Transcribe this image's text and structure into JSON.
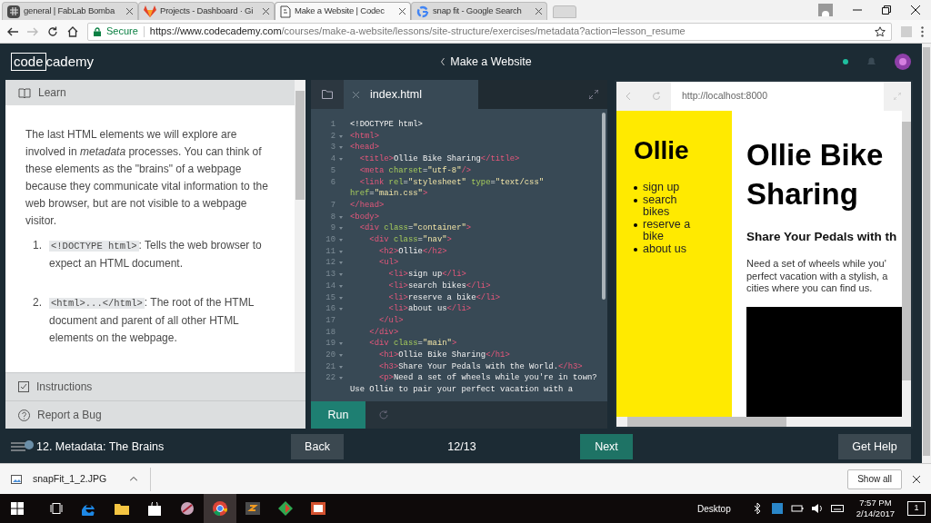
{
  "browser": {
    "tabs": [
      {
        "title": "general | FabLab Bomba",
        "kind": "hash",
        "selected": false
      },
      {
        "title": "Projects - Dashboard · Gi",
        "kind": "fox",
        "selected": false
      },
      {
        "title": "Make a Website | Codec",
        "kind": "page",
        "selected": true
      },
      {
        "title": "snap fit - Google Search",
        "kind": "g",
        "selected": false
      }
    ],
    "secure_label": "Secure",
    "url_host": "https://www.codecademy.com",
    "url_path": "/courses/make-a-website/lessons/site-structure/exercises/metadata?action=lesson_resume"
  },
  "header": {
    "logo_boxed": "code",
    "logo_rest": "cademy",
    "course": "Make a Website"
  },
  "learn": {
    "tabs": [
      {
        "label": "Learn",
        "kind": "book"
      },
      {
        "label": "Instructions",
        "kind": "check"
      },
      {
        "label": "Report a Bug",
        "kind": "help"
      }
    ],
    "intro": "The last HTML elements we will explore are involved in *metadata* processes. You can think of these elements as the \"brains\" of a webpage because they communicate vital information to the web browser, but are not visible to a webpage visitor.",
    "items": [
      {
        "number": "1.",
        "code": "<!DOCTYPE html>",
        "text": ": Tells the web browser to expect an HTML document."
      },
      {
        "number": "2.",
        "code": "<html>...</html>",
        "text": ": The root of the HTML document and parent of all other HTML elements on the webpage."
      }
    ]
  },
  "editor": {
    "file": "index.html",
    "run": "Run",
    "lines": [
      {
        "kind": "line",
        "number": "1",
        "foldable": false,
        "tokens": [
          {
            "kind": "text",
            "text": "<!DOCTYPE html>"
          }
        ]
      },
      {
        "kind": "line",
        "number": "2",
        "foldable": true,
        "tokens": [
          {
            "kind": "tag",
            "text": "<html>"
          }
        ]
      },
      {
        "kind": "line",
        "number": "3",
        "foldable": true,
        "tokens": [
          {
            "kind": "tag",
            "text": "<head>"
          }
        ]
      },
      {
        "kind": "line",
        "number": "4",
        "foldable": true,
        "tokens": [
          {
            "kind": "tag",
            "text": "  <title>"
          },
          {
            "kind": "text",
            "text": "Ollie Bike Sharing"
          },
          {
            "kind": "tag",
            "text": "</title>"
          }
        ]
      },
      {
        "kind": "line",
        "number": "5",
        "foldable": false,
        "tokens": [
          {
            "kind": "tag",
            "text": "  <meta"
          },
          {
            "kind": "attr",
            "text": " charset"
          },
          {
            "kind": "text",
            "text": "="
          },
          {
            "kind": "string",
            "text": "\"utf-8\""
          },
          {
            "kind": "tag",
            "text": "/>"
          }
        ]
      },
      {
        "kind": "line",
        "number": "6",
        "foldable": false,
        "tokens": [
          {
            "kind": "tag",
            "text": "  <link"
          },
          {
            "kind": "attr",
            "text": " rel"
          },
          {
            "kind": "text",
            "text": "="
          },
          {
            "kind": "string",
            "text": "\"stylesheet\""
          },
          {
            "kind": "attr",
            "text": " type"
          },
          {
            "kind": "text",
            "text": "="
          },
          {
            "kind": "string",
            "text": "\"text/css\""
          }
        ]
      },
      {
        "kind": "wrap",
        "tokens": [
          {
            "kind": "attr",
            "text": "href"
          },
          {
            "kind": "text",
            "text": "="
          },
          {
            "kind": "string",
            "text": "\"main.css\""
          },
          {
            "kind": "tag",
            "text": ">"
          }
        ]
      },
      {
        "kind": "line",
        "number": "7",
        "foldable": false,
        "tokens": [
          {
            "kind": "tag",
            "text": "</head>"
          }
        ]
      },
      {
        "kind": "line",
        "number": "8",
        "foldable": true,
        "tokens": [
          {
            "kind": "tag",
            "text": "<body>"
          }
        ]
      },
      {
        "kind": "line",
        "number": "9",
        "foldable": true,
        "tokens": [
          {
            "kind": "tag",
            "text": "  <div"
          },
          {
            "kind": "attr",
            "text": " class"
          },
          {
            "kind": "text",
            "text": "="
          },
          {
            "kind": "string",
            "text": "\"container\""
          },
          {
            "kind": "tag",
            "text": ">"
          }
        ]
      },
      {
        "kind": "line",
        "number": "10",
        "foldable": true,
        "tokens": [
          {
            "kind": "tag",
            "text": "    <div"
          },
          {
            "kind": "attr",
            "text": " class"
          },
          {
            "kind": "text",
            "text": "="
          },
          {
            "kind": "string",
            "text": "\"nav\""
          },
          {
            "kind": "tag",
            "text": ">"
          }
        ]
      },
      {
        "kind": "line",
        "number": "11",
        "foldable": true,
        "tokens": [
          {
            "kind": "tag",
            "text": "      <h2>"
          },
          {
            "kind": "text",
            "text": "Ollie"
          },
          {
            "kind": "tag",
            "text": "</h2>"
          }
        ]
      },
      {
        "kind": "line",
        "number": "12",
        "foldable": true,
        "tokens": [
          {
            "kind": "tag",
            "text": "      <ul>"
          }
        ]
      },
      {
        "kind": "line",
        "number": "13",
        "foldable": true,
        "tokens": [
          {
            "kind": "tag",
            "text": "        <li>"
          },
          {
            "kind": "text",
            "text": "sign up"
          },
          {
            "kind": "tag",
            "text": "</li>"
          }
        ]
      },
      {
        "kind": "line",
        "number": "14",
        "foldable": true,
        "tokens": [
          {
            "kind": "tag",
            "text": "        <li>"
          },
          {
            "kind": "text",
            "text": "search bikes"
          },
          {
            "kind": "tag",
            "text": "</li>"
          }
        ]
      },
      {
        "kind": "line",
        "number": "15",
        "foldable": true,
        "tokens": [
          {
            "kind": "tag",
            "text": "        <li>"
          },
          {
            "kind": "text",
            "text": "reserve a bike"
          },
          {
            "kind": "tag",
            "text": "</li>"
          }
        ]
      },
      {
        "kind": "line",
        "number": "16",
        "foldable": true,
        "tokens": [
          {
            "kind": "tag",
            "text": "        <li>"
          },
          {
            "kind": "text",
            "text": "about us"
          },
          {
            "kind": "tag",
            "text": "</li>"
          }
        ]
      },
      {
        "kind": "line",
        "number": "17",
        "foldable": false,
        "tokens": [
          {
            "kind": "tag",
            "text": "      </ul>"
          }
        ]
      },
      {
        "kind": "line",
        "number": "18",
        "foldable": false,
        "tokens": [
          {
            "kind": "tag",
            "text": "    </div>"
          }
        ]
      },
      {
        "kind": "line",
        "number": "19",
        "foldable": true,
        "tokens": [
          {
            "kind": "tag",
            "text": "    <div"
          },
          {
            "kind": "attr",
            "text": " class"
          },
          {
            "kind": "text",
            "text": "="
          },
          {
            "kind": "string",
            "text": "\"main\""
          },
          {
            "kind": "tag",
            "text": ">"
          }
        ]
      },
      {
        "kind": "line",
        "number": "20",
        "foldable": true,
        "tokens": [
          {
            "kind": "tag",
            "text": "      <h1>"
          },
          {
            "kind": "text",
            "text": "Ollie Bike Sharing"
          },
          {
            "kind": "tag",
            "text": "</h1>"
          }
        ]
      },
      {
        "kind": "line",
        "number": "21",
        "foldable": true,
        "tokens": [
          {
            "kind": "tag",
            "text": "      <h3>"
          },
          {
            "kind": "text",
            "text": "Share Your Pedals with the World."
          },
          {
            "kind": "tag",
            "text": "</h3>"
          }
        ]
      },
      {
        "kind": "line",
        "number": "22",
        "foldable": true,
        "tokens": [
          {
            "kind": "tag",
            "text": "      <p>"
          },
          {
            "kind": "text",
            "text": "Need a set of wheels while you're in town?"
          }
        ]
      },
      {
        "kind": "wrap",
        "tokens": [
          {
            "kind": "text",
            "text": "Use Ollie to pair your perfect vacation with a"
          }
        ]
      }
    ]
  },
  "preview": {
    "url": "http://localhost:8000",
    "nav_title": "Ollie",
    "nav_items": [
      "sign up",
      "search bikes",
      "reserve a bike",
      "about us"
    ],
    "heading": "Ollie Bike Sharing",
    "subheading": "Share Your Pedals with th",
    "paragraph_lines": [
      "Need a set of wheels while you'",
      "perfect vacation with a stylish, a",
      "cities where you can find us."
    ]
  },
  "footer": {
    "lesson": "12. Metadata: The Brains",
    "back": "Back",
    "progress": "12/13",
    "next": "Next",
    "help": "Get Help"
  },
  "downloads": {
    "file": "snapFit_1_2.JPG",
    "show_all": "Show all"
  },
  "taskbar": {
    "desktop": "Desktop",
    "time": "7:57 PM",
    "date": "2/14/2017",
    "notifications": "1"
  }
}
